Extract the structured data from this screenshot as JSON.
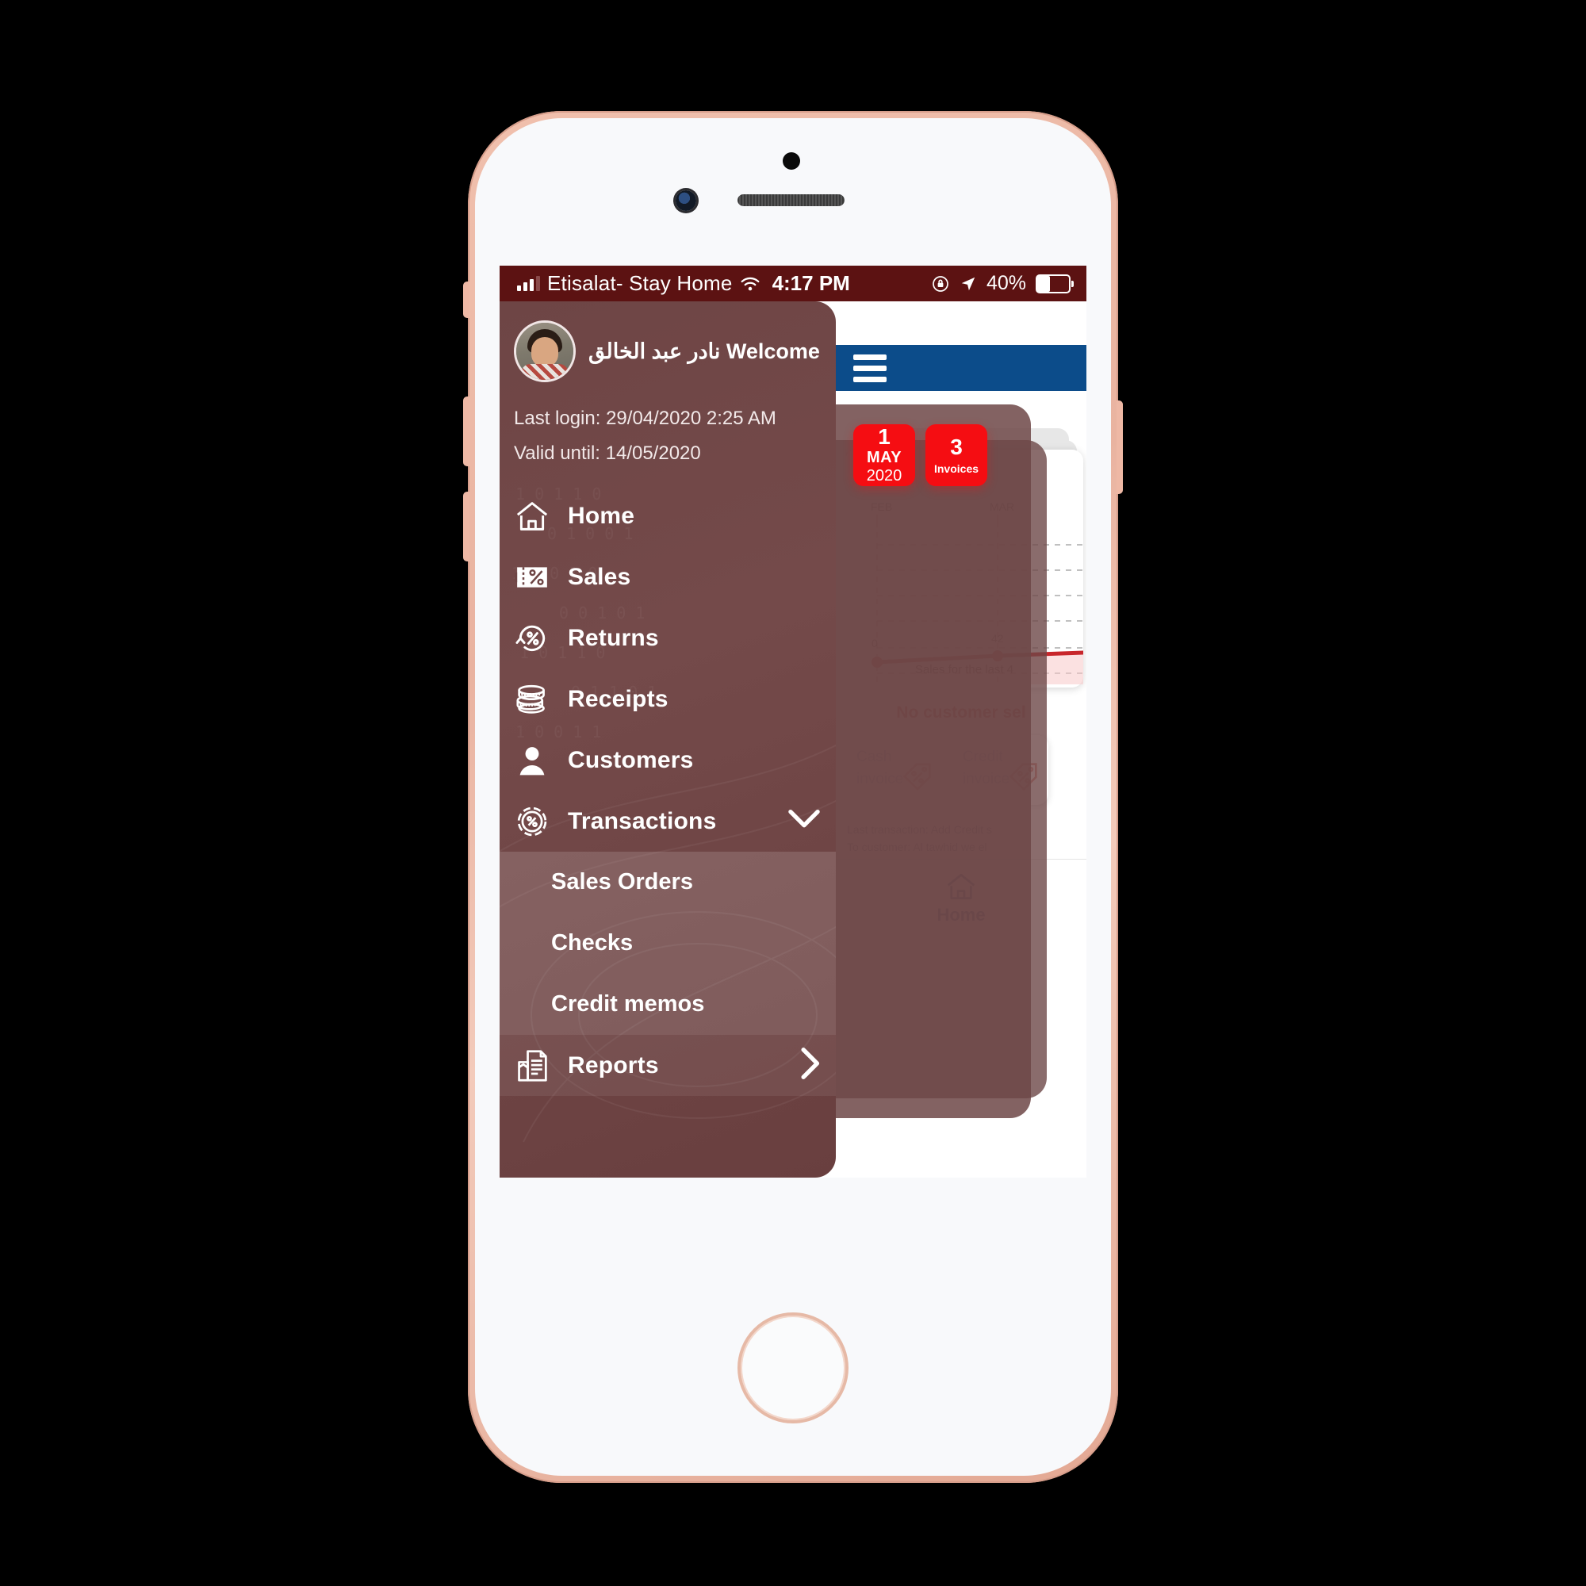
{
  "status_bar": {
    "carrier": "Etisalat- Stay Home",
    "time": "4:17 PM",
    "battery_pct": "40%",
    "signal_icon": "signal-bars-icon",
    "wifi_icon": "wifi-icon",
    "rotation_lock_icon": "rotation-lock-icon",
    "location_icon": "location-arrow-icon",
    "battery_icon": "battery-icon",
    "bg_color": "#5c1212"
  },
  "drawer": {
    "welcome": "Welcome نادر عبد الخالق",
    "last_login": "Last login: 29/04/2020 2:25 AM",
    "valid_until": "Valid until: 14/05/2020",
    "avatar_icon": "user-avatar",
    "bg_color": "#6e4545",
    "items": [
      {
        "label": "Home",
        "icon": "home-icon"
      },
      {
        "label": "Sales",
        "icon": "sales-ticket-percent-icon"
      },
      {
        "label": "Returns",
        "icon": "return-arrow-percent-icon"
      },
      {
        "label": "Receipts",
        "icon": "coins-stack-icon"
      },
      {
        "label": "Customers",
        "icon": "person-icon"
      },
      {
        "label": "Transactions",
        "icon": "circle-percent-icon",
        "expand_icon": "chevron-down-icon",
        "expanded": true
      },
      {
        "label": "Reports",
        "icon": "report-document-icon",
        "expand_icon": "chevron-right-icon",
        "expanded": false
      }
    ],
    "submenu": [
      {
        "label": "Sales Orders"
      },
      {
        "label": "Checks"
      },
      {
        "label": "Credit memos"
      }
    ]
  },
  "app": {
    "appbar": {
      "menu_icon": "hamburger-menu-icon",
      "bg_color": "#0c4c8a"
    },
    "date_card": {
      "day": "1",
      "month": "MAY",
      "year": "2020"
    },
    "invoices_card": {
      "count": "3",
      "label": "Invoices"
    },
    "no_customer": "No customer sel",
    "invoice_buttons": [
      {
        "line1": "Cash",
        "line2": "invoice",
        "icon": "tag-percent-icon"
      },
      {
        "line1": "Credit",
        "line2": "invoice",
        "icon": "tag-percent-icon"
      }
    ],
    "last_transaction": "Last transaction: Add Credit s",
    "to_customer": "To customer:  Al tawhid we el",
    "bottom_nav": [
      {
        "label": "Home",
        "icon": "home-icon"
      }
    ]
  },
  "chart_data": {
    "type": "line",
    "title": "",
    "caption": "Sales for the last 4",
    "categories": [
      "FEB",
      "MAR"
    ],
    "x": [
      "FEB",
      "MAR"
    ],
    "values": [
      0,
      42
    ],
    "point_labels": [
      "0",
      "42"
    ],
    "series": [
      {
        "name": "Sales",
        "values": [
          0,
          42
        ],
        "color": "#c8262b"
      }
    ],
    "xlabel": "",
    "ylabel": "",
    "ylim": [
      0,
      260
    ],
    "grid": true,
    "grid_style": "dashed",
    "legend": "none",
    "area_fill": true
  }
}
